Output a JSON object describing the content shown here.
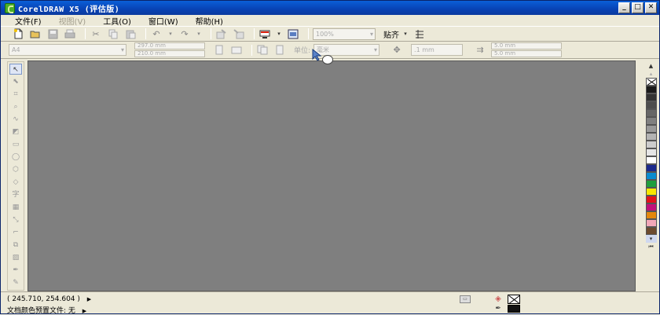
{
  "window": {
    "title": "CorelDRAW X5 (评估版)"
  },
  "menu": [
    {
      "label": "文件(F)",
      "disabled": false
    },
    {
      "label": "视图(V)",
      "disabled": true
    },
    {
      "label": "工具(O)",
      "disabled": false
    },
    {
      "label": "窗口(W)",
      "disabled": false
    },
    {
      "label": "帮助(H)",
      "disabled": false
    }
  ],
  "toolbar": {
    "zoom_value": "100%",
    "snap_label": "贴齐",
    "icons": [
      "new-icon",
      "open-icon",
      "save-icon",
      "print-icon",
      "cut-icon",
      "copy-icon",
      "paste-icon",
      "undo-icon",
      "redo-icon",
      "import-icon",
      "export-icon",
      "application-launcher-icon",
      "welcome-screen-icon",
      "snap-options-icon"
    ]
  },
  "property_bar": {
    "page_size": "A4",
    "width": "297.0 mm",
    "height": "210.0 mm",
    "units_label": "单位:",
    "units_value": "毫米",
    "nudge": ".1 mm",
    "duplicate_h": "5.0 mm",
    "duplicate_v": "5.0 mm"
  },
  "toolbox": {
    "tools": [
      "pick-tool-icon",
      "shape-tool-icon",
      "crop-tool-icon",
      "zoom-tool-icon",
      "freehand-tool-icon",
      "smart-fill-tool-icon",
      "rectangle-tool-icon",
      "ellipse-tool-icon",
      "polygon-tool-icon",
      "basic-shapes-tool-icon",
      "text-tool-icon",
      "table-tool-icon",
      "dimension-tool-icon",
      "connector-tool-icon",
      "blend-tool-icon",
      "transparency-tool-icon",
      "eyedropper-tool-icon",
      "outline-tool-icon",
      "fill-tool-icon"
    ],
    "text_tool_glyph": "字"
  },
  "palette": {
    "colors": [
      "#1a1a1a",
      "#333333",
      "#4d4d4d",
      "#666666",
      "#808080",
      "#999999",
      "#b3b3b3",
      "#cccccc",
      "#e6e6e6",
      "#ffffff",
      "#1c2a8c",
      "#0a8bcf",
      "#1f9e3e",
      "#f7e600",
      "#e2121a",
      "#c0117a",
      "#e3870c",
      "#f1a7b8",
      "#6b4a2e"
    ]
  },
  "status": {
    "coords": "( 245.710, 254.604 )",
    "profile": "文档颜色预置文件: 无"
  }
}
